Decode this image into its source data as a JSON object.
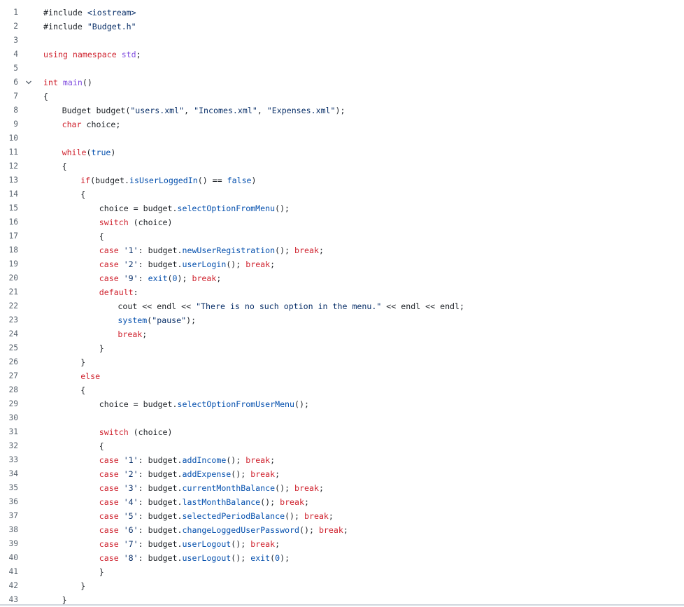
{
  "editor": {
    "lines": [
      {
        "n": "1",
        "indent": 0,
        "tokens": [
          {
            "t": "#include ",
            "c": "pl"
          },
          {
            "t": "<iostream>",
            "c": "str"
          }
        ]
      },
      {
        "n": "2",
        "indent": 0,
        "tokens": [
          {
            "t": "#include ",
            "c": "pl"
          },
          {
            "t": "\"Budget.h\"",
            "c": "str"
          }
        ]
      },
      {
        "n": "3",
        "indent": 0,
        "tokens": []
      },
      {
        "n": "4",
        "indent": 0,
        "tokens": [
          {
            "t": "using namespace ",
            "c": "kw"
          },
          {
            "t": "std",
            "c": "ty"
          },
          {
            "t": ";",
            "c": "pl"
          }
        ]
      },
      {
        "n": "5",
        "indent": 0,
        "tokens": []
      },
      {
        "n": "6",
        "indent": 0,
        "fold": true,
        "tokens": [
          {
            "t": "int ",
            "c": "kw"
          },
          {
            "t": "main",
            "c": "ty"
          },
          {
            "t": "()",
            "c": "pl"
          }
        ]
      },
      {
        "n": "7",
        "indent": 0,
        "tokens": [
          {
            "t": "{",
            "c": "pl"
          }
        ]
      },
      {
        "n": "8",
        "indent": 1,
        "tokens": [
          {
            "t": "Budget budget(",
            "c": "pl"
          },
          {
            "t": "\"users.xml\"",
            "c": "str"
          },
          {
            "t": ", ",
            "c": "pl"
          },
          {
            "t": "\"Incomes.xml\"",
            "c": "str"
          },
          {
            "t": ", ",
            "c": "pl"
          },
          {
            "t": "\"Expenses.xml\"",
            "c": "str"
          },
          {
            "t": ");",
            "c": "pl"
          }
        ]
      },
      {
        "n": "9",
        "indent": 1,
        "tokens": [
          {
            "t": "char ",
            "c": "kw"
          },
          {
            "t": "choice;",
            "c": "pl"
          }
        ]
      },
      {
        "n": "10",
        "indent": 0,
        "tokens": []
      },
      {
        "n": "11",
        "indent": 1,
        "tokens": [
          {
            "t": "while",
            "c": "kw"
          },
          {
            "t": "(",
            "c": "pl"
          },
          {
            "t": "true",
            "c": "fn"
          },
          {
            "t": ")",
            "c": "pl"
          }
        ]
      },
      {
        "n": "12",
        "indent": 1,
        "tokens": [
          {
            "t": "{",
            "c": "pl"
          }
        ]
      },
      {
        "n": "13",
        "indent": 2,
        "tokens": [
          {
            "t": "if",
            "c": "kw"
          },
          {
            "t": "(budget.",
            "c": "pl"
          },
          {
            "t": "isUserLoggedIn",
            "c": "fn"
          },
          {
            "t": "() == ",
            "c": "pl"
          },
          {
            "t": "false",
            "c": "fn"
          },
          {
            "t": ")",
            "c": "pl"
          }
        ]
      },
      {
        "n": "14",
        "indent": 2,
        "tokens": [
          {
            "t": "{",
            "c": "pl"
          }
        ]
      },
      {
        "n": "15",
        "indent": 3,
        "tokens": [
          {
            "t": "choice = budget.",
            "c": "pl"
          },
          {
            "t": "selectOptionFromMenu",
            "c": "fn"
          },
          {
            "t": "();",
            "c": "pl"
          }
        ]
      },
      {
        "n": "16",
        "indent": 3,
        "tokens": [
          {
            "t": "switch ",
            "c": "kw"
          },
          {
            "t": "(choice)",
            "c": "pl"
          }
        ]
      },
      {
        "n": "17",
        "indent": 3,
        "tokens": [
          {
            "t": "{",
            "c": "pl"
          }
        ]
      },
      {
        "n": "18",
        "indent": 3,
        "tokens": [
          {
            "t": "case ",
            "c": "kw"
          },
          {
            "t": "'1'",
            "c": "str"
          },
          {
            "t": ": budget.",
            "c": "pl"
          },
          {
            "t": "newUserRegistration",
            "c": "fn"
          },
          {
            "t": "(); ",
            "c": "pl"
          },
          {
            "t": "break",
            "c": "kw"
          },
          {
            "t": ";",
            "c": "pl"
          }
        ]
      },
      {
        "n": "19",
        "indent": 3,
        "tokens": [
          {
            "t": "case ",
            "c": "kw"
          },
          {
            "t": "'2'",
            "c": "str"
          },
          {
            "t": ": budget.",
            "c": "pl"
          },
          {
            "t": "userLogin",
            "c": "fn"
          },
          {
            "t": "(); ",
            "c": "pl"
          },
          {
            "t": "break",
            "c": "kw"
          },
          {
            "t": ";",
            "c": "pl"
          }
        ]
      },
      {
        "n": "20",
        "indent": 3,
        "tokens": [
          {
            "t": "case ",
            "c": "kw"
          },
          {
            "t": "'9'",
            "c": "str"
          },
          {
            "t": ": ",
            "c": "pl"
          },
          {
            "t": "exit",
            "c": "fn"
          },
          {
            "t": "(",
            "c": "pl"
          },
          {
            "t": "0",
            "c": "fn"
          },
          {
            "t": "); ",
            "c": "pl"
          },
          {
            "t": "break",
            "c": "kw"
          },
          {
            "t": ";",
            "c": "pl"
          }
        ]
      },
      {
        "n": "21",
        "indent": 3,
        "tokens": [
          {
            "t": "default",
            "c": "kw"
          },
          {
            "t": ":",
            "c": "pl"
          }
        ]
      },
      {
        "n": "22",
        "indent": 4,
        "tokens": [
          {
            "t": "cout << endl << ",
            "c": "pl"
          },
          {
            "t": "\"There is no such option in the menu.\"",
            "c": "str"
          },
          {
            "t": " << endl << endl;",
            "c": "pl"
          }
        ]
      },
      {
        "n": "23",
        "indent": 4,
        "tokens": [
          {
            "t": "system",
            "c": "fn"
          },
          {
            "t": "(",
            "c": "pl"
          },
          {
            "t": "\"pause\"",
            "c": "str"
          },
          {
            "t": ");",
            "c": "pl"
          }
        ]
      },
      {
        "n": "24",
        "indent": 4,
        "tokens": [
          {
            "t": "break",
            "c": "kw"
          },
          {
            "t": ";",
            "c": "pl"
          }
        ]
      },
      {
        "n": "25",
        "indent": 3,
        "tokens": [
          {
            "t": "}",
            "c": "pl"
          }
        ]
      },
      {
        "n": "26",
        "indent": 2,
        "tokens": [
          {
            "t": "}",
            "c": "pl"
          }
        ]
      },
      {
        "n": "27",
        "indent": 2,
        "tokens": [
          {
            "t": "else",
            "c": "kw"
          }
        ]
      },
      {
        "n": "28",
        "indent": 2,
        "tokens": [
          {
            "t": "{",
            "c": "pl"
          }
        ]
      },
      {
        "n": "29",
        "indent": 3,
        "tokens": [
          {
            "t": "choice = budget.",
            "c": "pl"
          },
          {
            "t": "selectOptionFromUserMenu",
            "c": "fn"
          },
          {
            "t": "();",
            "c": "pl"
          }
        ]
      },
      {
        "n": "30",
        "indent": 0,
        "tokens": []
      },
      {
        "n": "31",
        "indent": 3,
        "tokens": [
          {
            "t": "switch ",
            "c": "kw"
          },
          {
            "t": "(choice)",
            "c": "pl"
          }
        ]
      },
      {
        "n": "32",
        "indent": 3,
        "tokens": [
          {
            "t": "{",
            "c": "pl"
          }
        ]
      },
      {
        "n": "33",
        "indent": 3,
        "tokens": [
          {
            "t": "case ",
            "c": "kw"
          },
          {
            "t": "'1'",
            "c": "str"
          },
          {
            "t": ": budget.",
            "c": "pl"
          },
          {
            "t": "addIncome",
            "c": "fn"
          },
          {
            "t": "(); ",
            "c": "pl"
          },
          {
            "t": "break",
            "c": "kw"
          },
          {
            "t": ";",
            "c": "pl"
          }
        ]
      },
      {
        "n": "34",
        "indent": 3,
        "tokens": [
          {
            "t": "case ",
            "c": "kw"
          },
          {
            "t": "'2'",
            "c": "str"
          },
          {
            "t": ": budget.",
            "c": "pl"
          },
          {
            "t": "addExpense",
            "c": "fn"
          },
          {
            "t": "(); ",
            "c": "pl"
          },
          {
            "t": "break",
            "c": "kw"
          },
          {
            "t": ";",
            "c": "pl"
          }
        ]
      },
      {
        "n": "35",
        "indent": 3,
        "tokens": [
          {
            "t": "case ",
            "c": "kw"
          },
          {
            "t": "'3'",
            "c": "str"
          },
          {
            "t": ": budget.",
            "c": "pl"
          },
          {
            "t": "currentMonthBalance",
            "c": "fn"
          },
          {
            "t": "(); ",
            "c": "pl"
          },
          {
            "t": "break",
            "c": "kw"
          },
          {
            "t": ";",
            "c": "pl"
          }
        ]
      },
      {
        "n": "36",
        "indent": 3,
        "tokens": [
          {
            "t": "case ",
            "c": "kw"
          },
          {
            "t": "'4'",
            "c": "str"
          },
          {
            "t": ": budget.",
            "c": "pl"
          },
          {
            "t": "lastMonthBalance",
            "c": "fn"
          },
          {
            "t": "(); ",
            "c": "pl"
          },
          {
            "t": "break",
            "c": "kw"
          },
          {
            "t": ";",
            "c": "pl"
          }
        ]
      },
      {
        "n": "37",
        "indent": 3,
        "tokens": [
          {
            "t": "case ",
            "c": "kw"
          },
          {
            "t": "'5'",
            "c": "str"
          },
          {
            "t": ": budget.",
            "c": "pl"
          },
          {
            "t": "selectedPeriodBalance",
            "c": "fn"
          },
          {
            "t": "(); ",
            "c": "pl"
          },
          {
            "t": "break",
            "c": "kw"
          },
          {
            "t": ";",
            "c": "pl"
          }
        ]
      },
      {
        "n": "38",
        "indent": 3,
        "tokens": [
          {
            "t": "case ",
            "c": "kw"
          },
          {
            "t": "'6'",
            "c": "str"
          },
          {
            "t": ": budget.",
            "c": "pl"
          },
          {
            "t": "changeLoggedUserPassword",
            "c": "fn"
          },
          {
            "t": "(); ",
            "c": "pl"
          },
          {
            "t": "break",
            "c": "kw"
          },
          {
            "t": ";",
            "c": "pl"
          }
        ]
      },
      {
        "n": "39",
        "indent": 3,
        "tokens": [
          {
            "t": "case ",
            "c": "kw"
          },
          {
            "t": "'7'",
            "c": "str"
          },
          {
            "t": ": budget.",
            "c": "pl"
          },
          {
            "t": "userLogout",
            "c": "fn"
          },
          {
            "t": "(); ",
            "c": "pl"
          },
          {
            "t": "break",
            "c": "kw"
          },
          {
            "t": ";",
            "c": "pl"
          }
        ]
      },
      {
        "n": "40",
        "indent": 3,
        "tokens": [
          {
            "t": "case ",
            "c": "kw"
          },
          {
            "t": "'8'",
            "c": "str"
          },
          {
            "t": ": budget.",
            "c": "pl"
          },
          {
            "t": "userLogout",
            "c": "fn"
          },
          {
            "t": "(); ",
            "c": "pl"
          },
          {
            "t": "exit",
            "c": "fn"
          },
          {
            "t": "(",
            "c": "pl"
          },
          {
            "t": "0",
            "c": "fn"
          },
          {
            "t": ");",
            "c": "pl"
          }
        ]
      },
      {
        "n": "41",
        "indent": 3,
        "tokens": [
          {
            "t": "}",
            "c": "pl"
          }
        ]
      },
      {
        "n": "42",
        "indent": 2,
        "tokens": [
          {
            "t": "}",
            "c": "pl"
          }
        ]
      },
      {
        "n": "43",
        "indent": 1,
        "tokens": [
          {
            "t": "}",
            "c": "pl"
          }
        ]
      }
    ]
  },
  "colors": {
    "keyword": "#cf222e",
    "function": "#0550ae",
    "string": "#0a3069",
    "type": "#8250df",
    "plain": "#1f2328",
    "line_number": "#59636e"
  },
  "icons": {
    "fold": "chevron-down-icon"
  }
}
